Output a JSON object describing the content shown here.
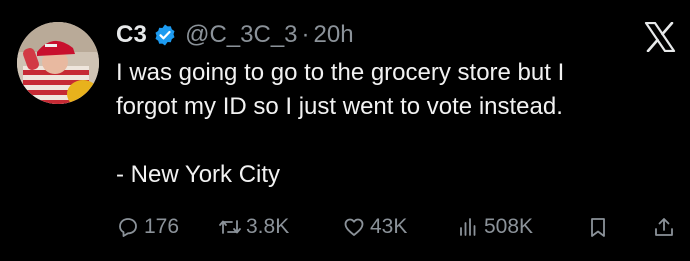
{
  "tweet": {
    "author": {
      "name": "C3",
      "handle": "@C_3C_3",
      "verified": true,
      "avatar": "avatar-image"
    },
    "separator": "·",
    "time": "20h",
    "platform_icon": "x-logo-icon",
    "text": {
      "line1": "I was going to go to the grocery store but I",
      "line2": "forgot my ID so I just went to vote instead.",
      "line3": "- New York City"
    },
    "stats": {
      "replies": "176",
      "reposts": "3.8K",
      "likes": "43K",
      "views": "508K"
    },
    "icons": {
      "reply": "speech-bubble-icon",
      "repost": "repost-arrows-icon",
      "like": "heart-icon",
      "views": "bar-chart-icon",
      "bookmark": "bookmark-icon",
      "share": "share-upload-icon"
    },
    "colors": {
      "background": "#000000",
      "text": "#e7e9ea",
      "muted": "#8b9299",
      "verified_blue": "#1d9bf0"
    }
  }
}
